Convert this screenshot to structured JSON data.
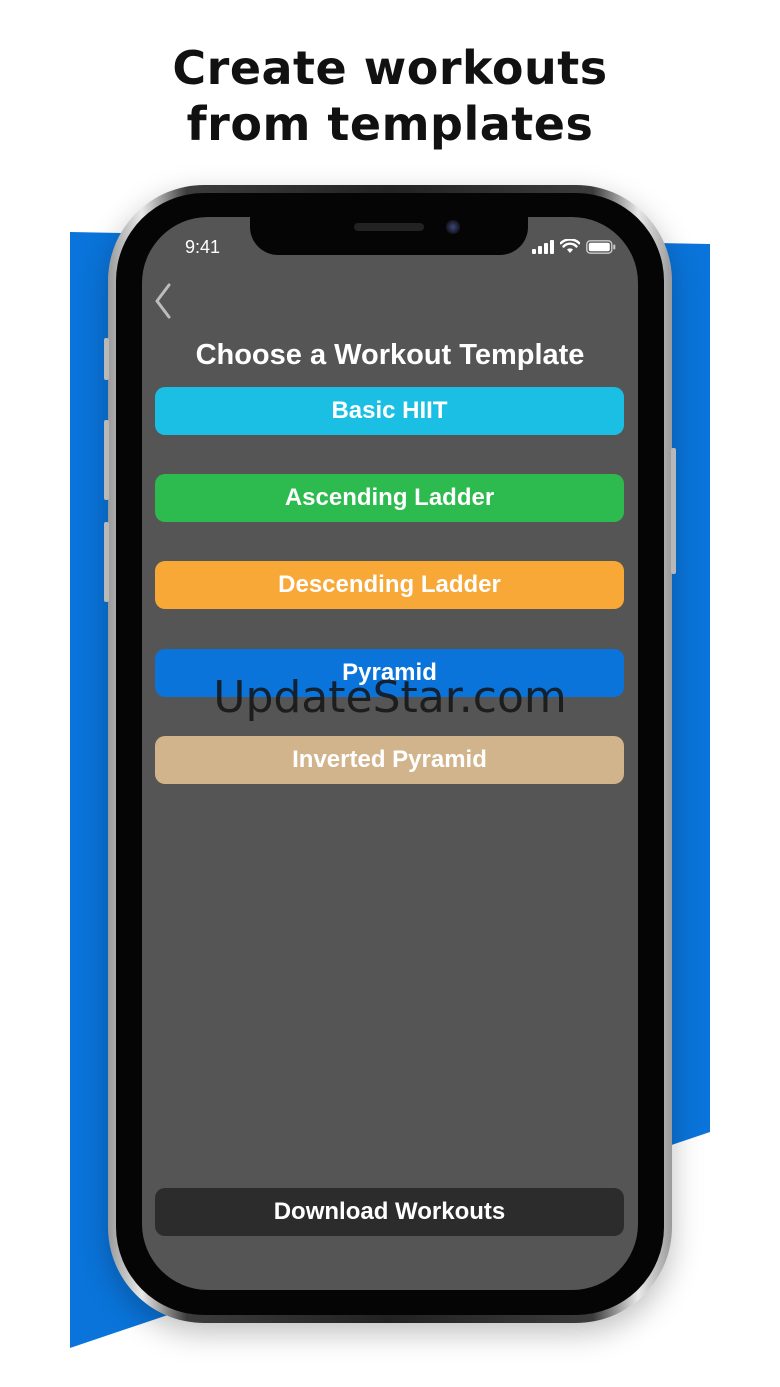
{
  "headline": {
    "line1": "Create workouts",
    "line2": "from templates"
  },
  "status_bar": {
    "time": "9:41",
    "icons": [
      "signal-icon",
      "wifi-icon",
      "battery-icon"
    ]
  },
  "screen": {
    "back_icon": "chevron-left-icon",
    "title": "Choose a Workout Template",
    "templates": [
      {
        "label": "Basic HIIT",
        "color": "#1ABFE3"
      },
      {
        "label": "Ascending Ladder",
        "color": "#2DBA4E"
      },
      {
        "label": "Descending Ladder",
        "color": "#F7A837"
      },
      {
        "label": "Pyramid",
        "color": "#0A74DA"
      },
      {
        "label": "Inverted Pyramid",
        "color": "#D2B48C"
      }
    ],
    "download_label": "Download Workouts"
  },
  "watermark": "UpdateStar.com",
  "colors": {
    "accent_blue": "#0A74DA",
    "screen_bg": "#555555"
  }
}
